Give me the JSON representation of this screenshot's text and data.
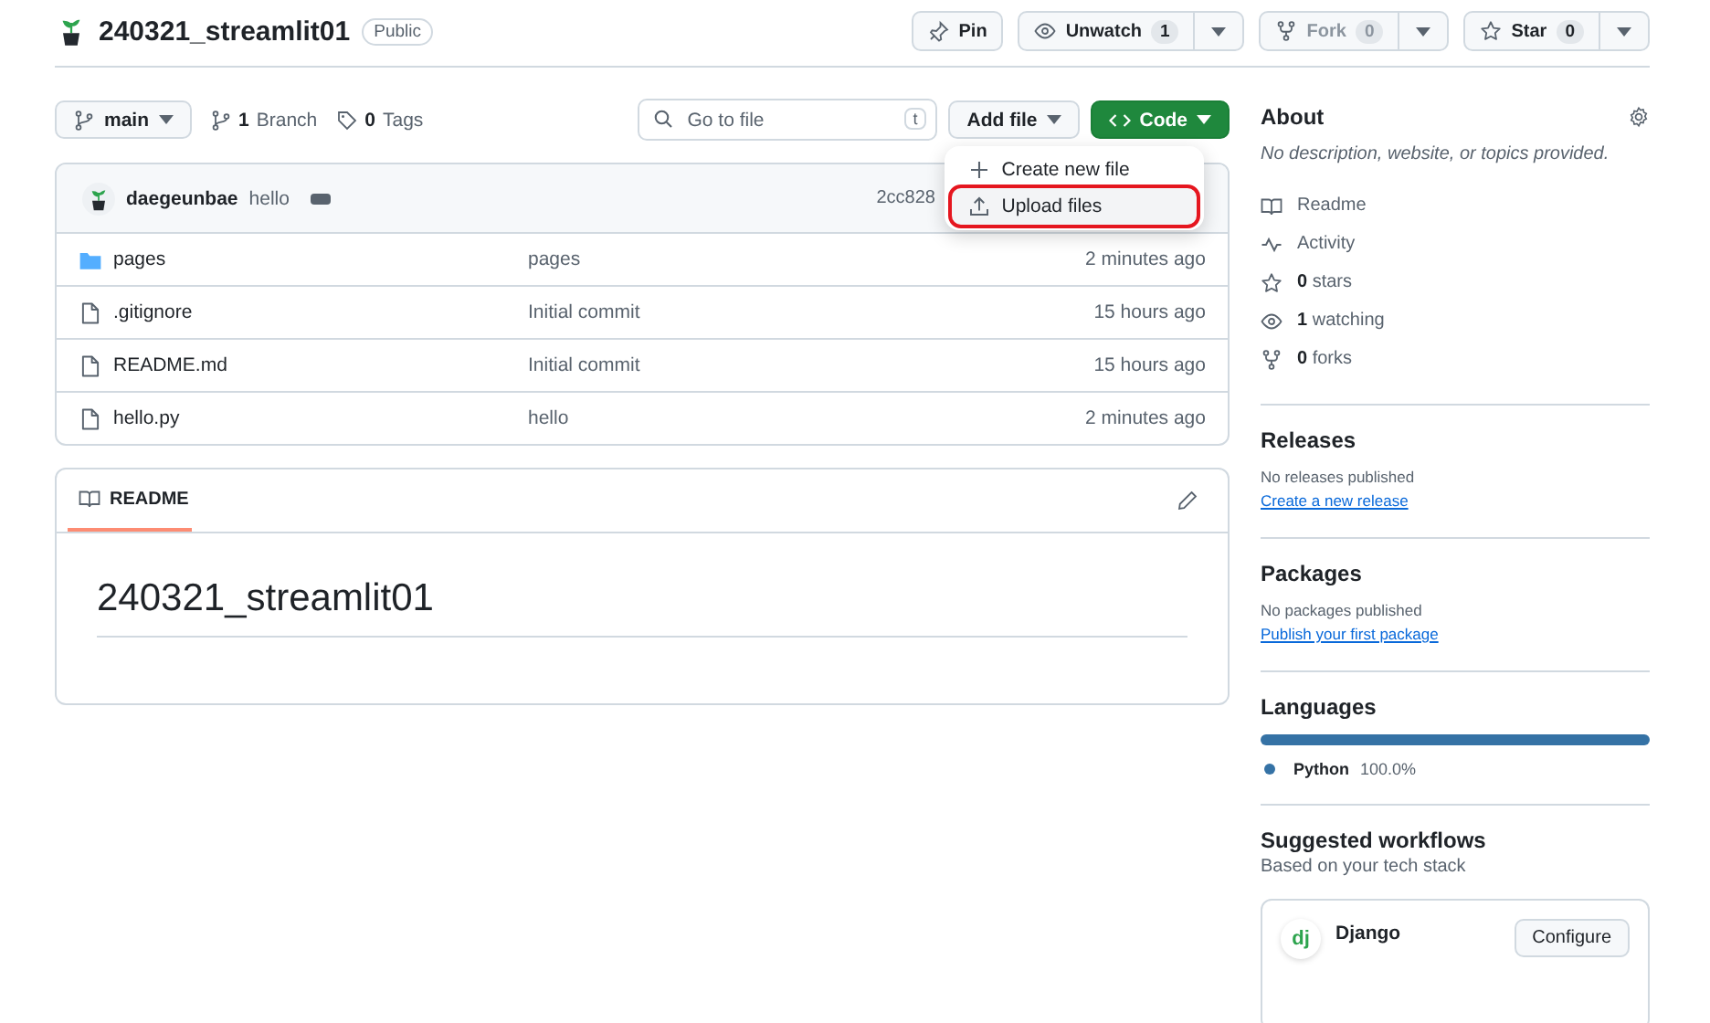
{
  "repo": {
    "name": "240321_streamlit01",
    "visibility": "Public"
  },
  "actions": [
    {
      "label": "Pin",
      "disabled": false
    },
    {
      "label": "Unwatch",
      "count": "1",
      "disabled": false
    },
    {
      "label": "Fork",
      "count": "0",
      "disabled": true
    },
    {
      "label": "Star",
      "count": "0",
      "disabled": false
    }
  ],
  "toolbar": {
    "branch": "main",
    "branches": {
      "count": "1",
      "label": "Branch"
    },
    "tags": {
      "count": "0",
      "label": "Tags"
    },
    "search": {
      "placeholder": "Go to file",
      "shortcut": "t"
    },
    "add_file": "Add file",
    "code": "Code"
  },
  "add_file_menu": [
    {
      "label": "Create new file",
      "highlighted": false
    },
    {
      "label": "Upload files",
      "highlighted": true
    }
  ],
  "commit": {
    "author": "daegeunbae",
    "message": "hello",
    "hash": "2cc828"
  },
  "files": [
    {
      "kind": "folder",
      "name": "pages",
      "message": "pages",
      "time": "2 minutes ago"
    },
    {
      "kind": "file",
      "name": ".gitignore",
      "message": "Initial commit",
      "time": "15 hours ago"
    },
    {
      "kind": "file",
      "name": "README.md",
      "message": "Initial commit",
      "time": "15 hours ago"
    },
    {
      "kind": "file",
      "name": "hello.py",
      "message": "hello",
      "time": "2 minutes ago"
    }
  ],
  "readme": {
    "tab": "README",
    "heading": "240321_streamlit01"
  },
  "about": {
    "title": "About",
    "description": "No description, website, or topics provided.",
    "items": [
      {
        "label": "Readme"
      },
      {
        "label": "Activity"
      },
      {
        "count": "0",
        "label": "stars"
      },
      {
        "count": "1",
        "label": "watching"
      },
      {
        "count": "0",
        "label": "forks"
      }
    ]
  },
  "releases": {
    "title": "Releases",
    "note": "No releases published",
    "link": "Create a new release"
  },
  "packages": {
    "title": "Packages",
    "note": "No packages published",
    "link": "Publish your first package"
  },
  "languages": {
    "title": "Languages",
    "items": [
      {
        "name": "Python",
        "percent": "100.0%",
        "level": 1,
        "color": "#3572a5"
      }
    ]
  },
  "workflows": {
    "title": "Suggested workflows",
    "subtitle": "Based on your tech stack",
    "items": [
      {
        "logo": "dj",
        "name": "Django",
        "button": "Configure"
      }
    ]
  }
}
